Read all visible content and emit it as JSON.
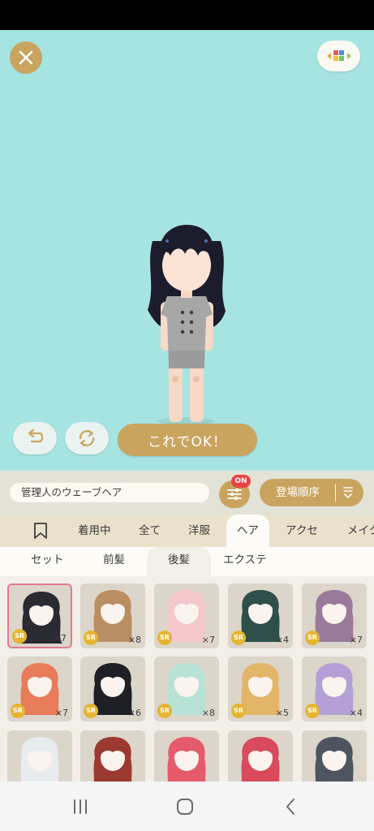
{
  "editor": {
    "ok_label": "これでOK！"
  },
  "item_bar": {
    "item_name": "管理人のウェーブヘア",
    "filter_badge": "ON",
    "sort_label": "登場順序"
  },
  "tabs": [
    {
      "label": "着用中"
    },
    {
      "label": "全て"
    },
    {
      "label": "洋服"
    },
    {
      "label": "ヘア",
      "active": true
    },
    {
      "label": "アクセ"
    },
    {
      "label": "メイク"
    }
  ],
  "subtabs": [
    {
      "label": "セット"
    },
    {
      "label": "前髪"
    },
    {
      "label": "後髪",
      "active": true
    },
    {
      "label": "エクステ"
    }
  ],
  "items": [
    {
      "rarity": "SR",
      "count": "×7",
      "hair": "#2a2a33",
      "selected": true
    },
    {
      "rarity": "SR",
      "count": "×8",
      "hair": "#b98e63"
    },
    {
      "rarity": "SR",
      "count": "×7",
      "hair": "#f3c7cc"
    },
    {
      "rarity": "SR",
      "count": "×4",
      "hair": "#2f4f4a"
    },
    {
      "rarity": "SR",
      "count": "×7",
      "hair": "#9a7a9a"
    },
    {
      "rarity": "SR",
      "count": "×7",
      "hair": "#e77b5a"
    },
    {
      "rarity": "SR",
      "count": "×6",
      "hair": "#1f1f26"
    },
    {
      "rarity": "SR",
      "count": "×8",
      "hair": "#b9e2d6"
    },
    {
      "rarity": "SR",
      "count": "×5",
      "hair": "#e3b569"
    },
    {
      "rarity": "SR",
      "count": "×4",
      "hair": "#b3a0d6"
    },
    {
      "rarity": "",
      "count": "",
      "hair": "#e8ecef"
    },
    {
      "rarity": "",
      "count": "",
      "hair": "#9c3a32"
    },
    {
      "rarity": "",
      "count": "",
      "hair": "#e55b6b"
    },
    {
      "rarity": "",
      "count": "",
      "hair": "#d94a5c"
    },
    {
      "rarity": "",
      "count": "",
      "hair": "#4d5560"
    }
  ],
  "colors": {
    "stage_bg": "#a6e4e2",
    "accent_gold": "#c9a45f",
    "badge_red": "#e54242",
    "rarity_yellow": "#e5b531",
    "selection_pink": "#e47a8f"
  }
}
